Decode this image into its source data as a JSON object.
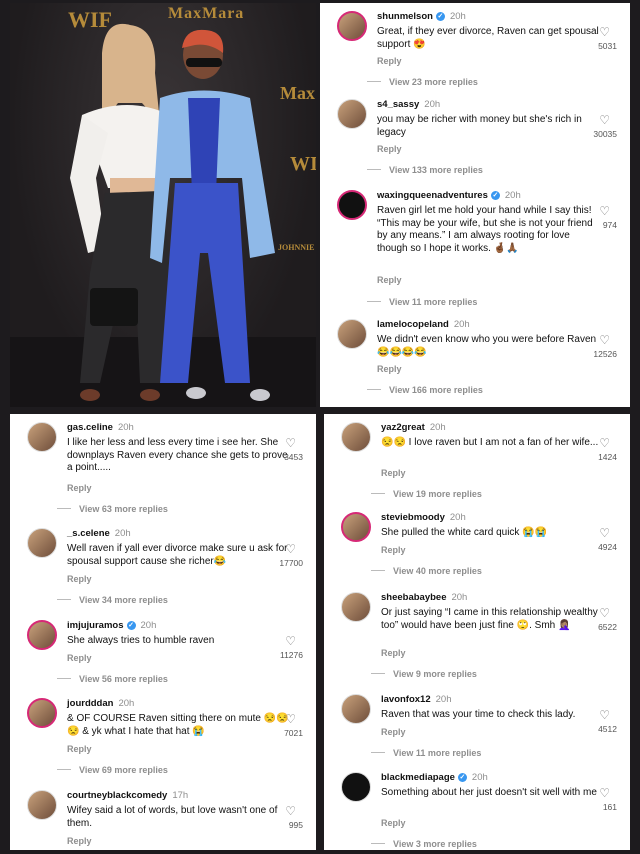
{
  "photo": {
    "backdrop_texts": [
      "WIF",
      "MaxMara",
      "Max",
      "WIF",
      "JOHNNIE"
    ],
    "colors": {
      "backdrop": "#231f21",
      "gold": "#b58b3a",
      "suit": "#8fb9e8",
      "pants": "#3b53c9"
    }
  },
  "panels": {
    "top_right": [
      {
        "user": "shunmelson",
        "verified": true,
        "time": "20h",
        "text": "Great,  if they ever divorce, Raven can get spousal support 😍",
        "likes": "5031",
        "reply": "Reply",
        "more": "View 23 more replies"
      },
      {
        "user": "s4_sassy",
        "verified": false,
        "time": "20h",
        "text": "you may be richer with money but she's rich in legacy",
        "likes": "30035",
        "reply": "Reply",
        "more": "View 133 more replies"
      },
      {
        "user": "waxingqueenadventures",
        "verified": true,
        "time": "20h",
        "text": "Raven girl let me hold your hand while I say this! “This may be your wife, but she is not your friend by any means.” I am always rooting for love though so I hope it works. 🤞🏾🙏🏾",
        "likes": "974",
        "reply": "Reply",
        "more": "View 11 more replies"
      },
      {
        "user": "lamelocopeland",
        "verified": false,
        "time": "20h",
        "text": "We didn't even know who you were before Raven 😂😂😂😂",
        "likes": "12526",
        "reply": "Reply",
        "more": "View 166 more replies"
      }
    ],
    "bottom_left": [
      {
        "user": "gas.celine",
        "verified": false,
        "time": "20h",
        "text": "I like her less and less every time i see her. She downplays Raven every chance she gets to prove a point.....",
        "likes": "3453",
        "reply": "Reply",
        "more": "View 63 more replies"
      },
      {
        "user": "_s.celene",
        "verified": false,
        "time": "20h",
        "text": "Well raven if yall ever divorce make sure u ask for  spousal support cause she richer😂",
        "likes": "17700",
        "reply": "Reply",
        "more": "View 34 more replies"
      },
      {
        "user": "imjujuramos",
        "verified": true,
        "time": "20h",
        "text": "She always tries to humble raven",
        "likes": "11276",
        "reply": "Reply",
        "more": "View 56 more replies"
      },
      {
        "user": "jourdddan",
        "verified": false,
        "time": "20h",
        "text": "& OF COURSE Raven sitting there on mute 😒😒😒 & yk what I hate that hat 😭",
        "likes": "7021",
        "reply": "Reply",
        "more": "View 69 more replies"
      },
      {
        "user": "courtneyblackcomedy",
        "verified": false,
        "time": "17h",
        "text": "Wifey said a lot of words, but love wasn't one of them.",
        "likes": "995",
        "reply": "Reply",
        "more": ""
      }
    ],
    "bottom_right": [
      {
        "user": "yaz2great",
        "verified": false,
        "time": "20h",
        "text": "😒😒 I love raven but I am not a fan of her wife...",
        "likes": "1424",
        "reply": "Reply",
        "more": "View 19 more replies"
      },
      {
        "user": "steviebmoody",
        "verified": false,
        "time": "20h",
        "text": "She pulled the white card quick 😭😭",
        "likes": "4924",
        "reply": "Reply",
        "more": "View 40 more replies"
      },
      {
        "user": "sheebabaybee",
        "verified": false,
        "time": "20h",
        "text": "Or just saying “I came in this relationship wealthy too” would have been just fine 🙄. Smh 🤦🏽‍♀️",
        "likes": "6522",
        "reply": "Reply",
        "more": "View 9 more replies"
      },
      {
        "user": "lavonfox12",
        "verified": false,
        "time": "20h",
        "text": "Raven that was your time to check this lady.",
        "likes": "4512",
        "reply": "Reply",
        "more": "View 11 more replies"
      },
      {
        "user": "blackmediapage",
        "verified": true,
        "time": "20h",
        "text": "Something about her just doesn't sit well with me",
        "likes": "161",
        "reply": "Reply",
        "more": "View 3 more replies"
      }
    ]
  },
  "icons": {
    "heart": "heart-outline-icon",
    "verified": "verified-badge-icon"
  }
}
